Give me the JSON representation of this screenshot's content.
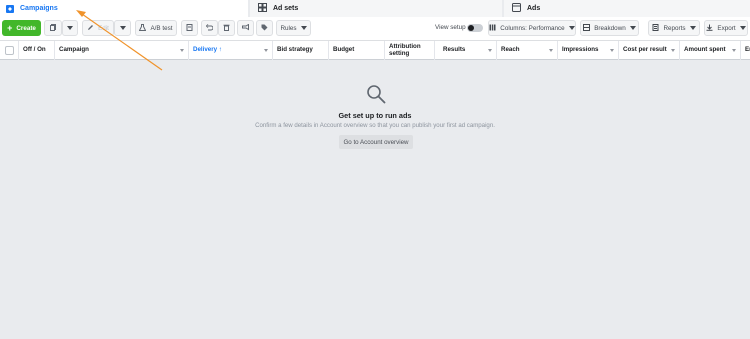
{
  "tabs": {
    "campaigns": "Campaigns",
    "ad_sets": "Ad sets",
    "ads": "Ads"
  },
  "toolbar": {
    "create": "Create",
    "edit": "Edit",
    "ab_test": "A/B test",
    "rules": "Rules",
    "view_setup": "View setup",
    "columns": "Columns: Performance",
    "breakdown": "Breakdown",
    "reports": "Reports",
    "export": "Export"
  },
  "columns": [
    "Off / On",
    "Campaign",
    "Delivery ↑",
    "Bid strategy",
    "Budget",
    "Attribution setting",
    "Results",
    "Reach",
    "Impressions",
    "Cost per result",
    "Amount spent",
    "En"
  ],
  "empty_state": {
    "title": "Get set up to run ads",
    "subtitle": "Confirm a few details in Account overview so that you can publish your first ad campaign.",
    "button": "Go to Account overview"
  },
  "colors": {
    "brand_blue": "#1877f2",
    "create_green": "#42b72a",
    "annotation_arrow": "#f0932b"
  },
  "icons": {
    "campaigns": "campaigns-icon",
    "ad_sets": "ad-sets-icon",
    "ads": "ads-icon",
    "empty_state": "magnifier-icon"
  }
}
